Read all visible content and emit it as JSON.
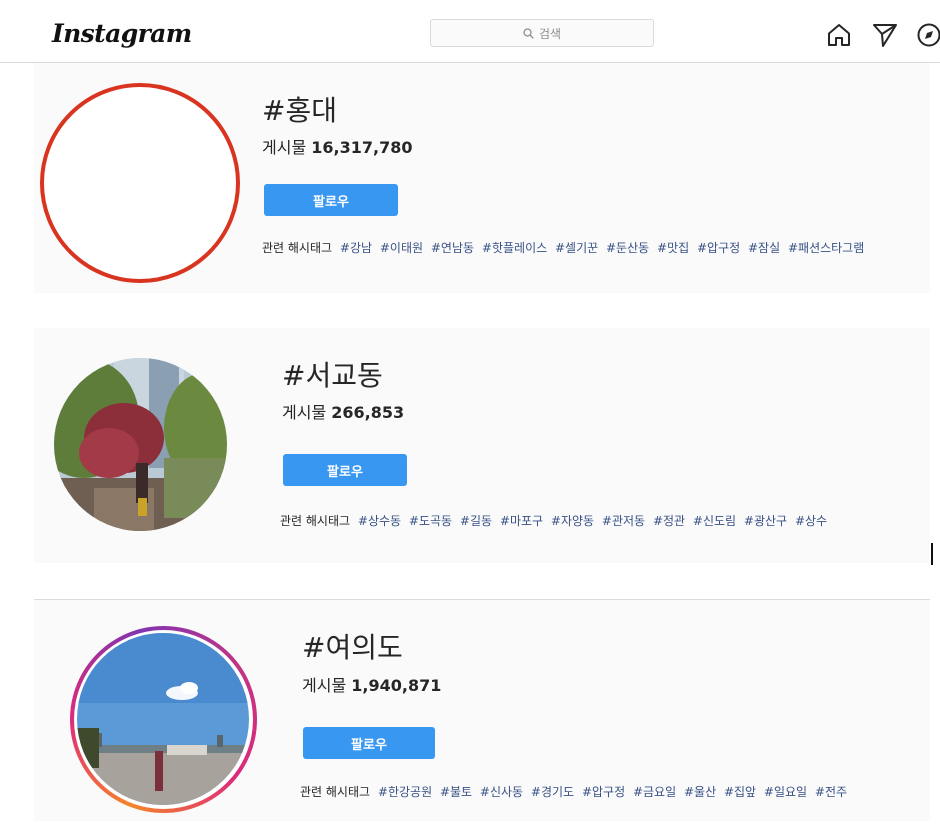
{
  "app": {
    "logo": "Instagram",
    "search_placeholder": "검색",
    "icons": [
      "search-icon",
      "home-icon",
      "direct-icon",
      "explore-icon"
    ]
  },
  "colors": {
    "follow_button": "#3897f0",
    "related_tag": "#385185",
    "red_ring": "#d8341f"
  },
  "labels": {
    "posts": "게시물",
    "follow": "팔로우",
    "related": "관련 해시태그"
  },
  "hashtags": [
    {
      "title": "#홍대",
      "post_count": "16,317,780",
      "related": [
        "#강남",
        "#이태원",
        "#연남동",
        "#핫플레이스",
        "#셀기꾼",
        "#둔산동",
        "#맛집",
        "#압구정",
        "#잠실",
        "#패션스타그램"
      ]
    },
    {
      "title": "#서교동",
      "post_count": "266,853",
      "related": [
        "#상수동",
        "#도곡동",
        "#길동",
        "#마포구",
        "#자양동",
        "#관저동",
        "#정관",
        "#신도림",
        "#광산구",
        "#상수"
      ]
    },
    {
      "title": "#여의도",
      "post_count": "1,940,871",
      "related": [
        "#한강공원",
        "#불토",
        "#신사동",
        "#경기도",
        "#압구정",
        "#금요일",
        "#울산",
        "#집앞",
        "#일요일",
        "#전주"
      ]
    }
  ]
}
